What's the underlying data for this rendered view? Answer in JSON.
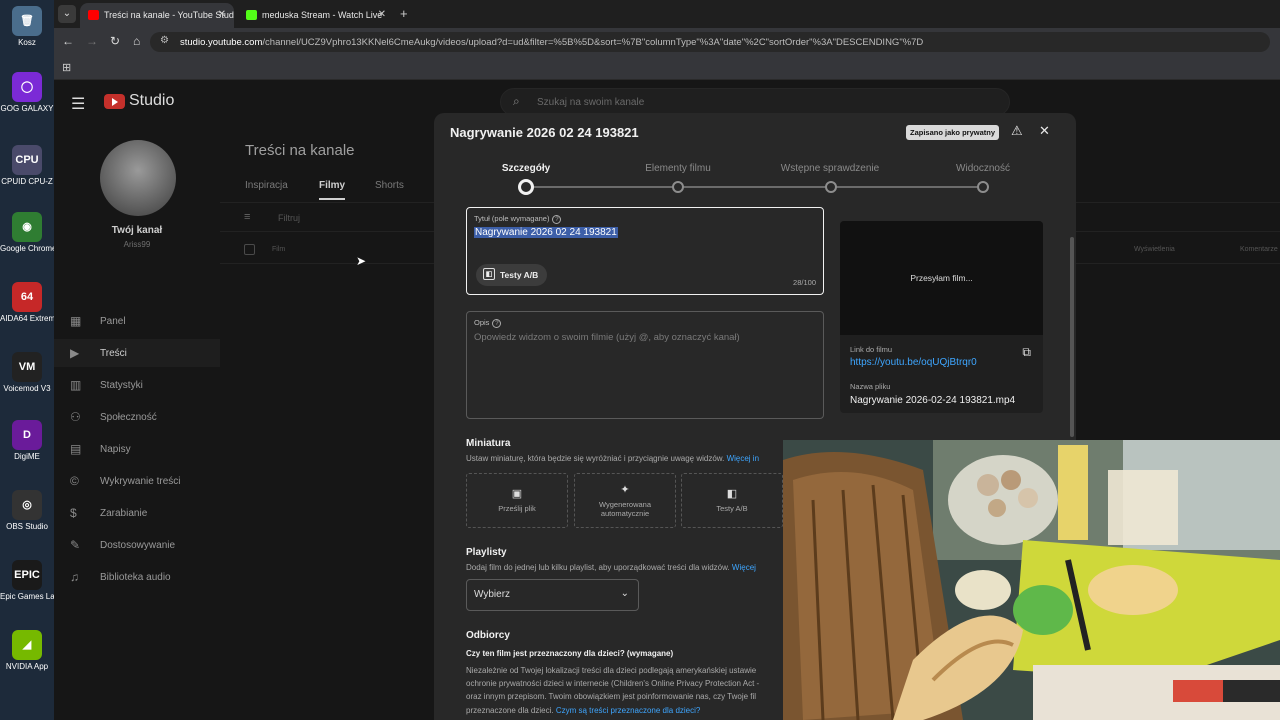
{
  "desktop": {
    "icons": [
      {
        "label": "Kosz",
        "icon": "recycle-bin-icon",
        "color": "#4a6d8c",
        "glyph": "🗑"
      },
      {
        "label": "GOG GALAXY",
        "icon": "gog-galaxy-icon",
        "color": "#7b2ad6",
        "glyph": "◯"
      },
      {
        "label": "CPUID CPU-Z",
        "icon": "cpuz-icon",
        "color": "#4a4a6a",
        "glyph": "CPU"
      },
      {
        "label": "Google Chrome",
        "icon": "chrome-icon",
        "color": "#2f7d32",
        "glyph": "◉"
      },
      {
        "label": "AIDA64 Extreme",
        "icon": "aida64-icon",
        "color": "#c62828",
        "glyph": "64"
      },
      {
        "label": "Voicemod V3",
        "icon": "voicemod-icon",
        "color": "#222222",
        "glyph": "VM"
      },
      {
        "label": "DigiME",
        "icon": "digime-icon",
        "color": "#6a1b9a",
        "glyph": "D"
      },
      {
        "label": "OBS Studio",
        "icon": "obs-icon",
        "color": "#333333",
        "glyph": "◎"
      },
      {
        "label": "Epic Games Launcher",
        "icon": "epic-games-icon",
        "color": "#1a1a1a",
        "glyph": "EPIC"
      },
      {
        "label": "NVIDIA App",
        "icon": "nvidia-icon",
        "color": "#76b900",
        "glyph": "◢"
      }
    ]
  },
  "browser": {
    "tabs": [
      {
        "title": "Treści na kanale - YouTube Studio",
        "favicon_color": "#ff0000",
        "active": true
      },
      {
        "title": "meduska Stream - Watch Live",
        "favicon_color": "#53fc18",
        "active": false
      }
    ],
    "url_site": "studio.youtube.com",
    "url_path": "/channel/UCZ9Vphro13KKNel6CmeAukg/videos/upload?d=ud&filter=%5B%5D&sort=%7B\"columnType\"%3A\"date\"%2C\"sortOrder\"%3A\"DESCENDING\"%7D"
  },
  "studio": {
    "logo_text": "Studio",
    "search_placeholder": "Szukaj na swoim kanale",
    "channel": {
      "title": "Twój kanał",
      "name": "Ariss99"
    },
    "nav": [
      {
        "label": "Panel",
        "icon": "dashboard-icon",
        "glyph": "▦"
      },
      {
        "label": "Treści",
        "icon": "content-icon",
        "glyph": "▶"
      },
      {
        "label": "Statystyki",
        "icon": "analytics-icon",
        "glyph": "▥"
      },
      {
        "label": "Społeczność",
        "icon": "community-icon",
        "glyph": "⚇"
      },
      {
        "label": "Napisy",
        "icon": "subtitles-icon",
        "glyph": "▤"
      },
      {
        "label": "Wykrywanie treści",
        "icon": "copyright-icon",
        "glyph": "©"
      },
      {
        "label": "Zarabianie",
        "icon": "monetization-icon",
        "glyph": "$"
      },
      {
        "label": "Dostosowywanie",
        "icon": "customization-icon",
        "glyph": "✎"
      },
      {
        "label": "Biblioteka audio",
        "icon": "audio-library-icon",
        "glyph": "♫"
      }
    ],
    "active_nav": "Treści",
    "content_title": "Treści na kanale",
    "content_tabs": [
      "Inspiracja",
      "Filmy",
      "Shorts"
    ],
    "active_tab": "Filmy",
    "filter_text": "Filtruj",
    "columns": [
      "Film",
      "Wyświetlenia",
      "Komentarze"
    ]
  },
  "dialog": {
    "title": "Nagrywanie 2026 02 24 193821",
    "saved_badge": "Zapisano jako prywatny",
    "steps": [
      "Szczegóły",
      "Elementy filmu",
      "Wstępne sprawdzenie",
      "Widoczność"
    ],
    "current_step": 0,
    "title_field": {
      "label": "Tytuł (pole wymagane)",
      "value": "Nagrywanie 2026 02 24 193821",
      "counter": "28/100",
      "ab_label": "Testy A/B"
    },
    "description_field": {
      "label": "Opis",
      "placeholder": "Opowiedz widzom o swoim filmie (użyj @, aby oznaczyć kanał)"
    },
    "preview": {
      "status": "Przesyłam film...",
      "link_label": "Link do filmu",
      "link": "https://youtu.be/oqUQjBtrqr0",
      "file_label": "Nazwa pliku",
      "file_name": "Nagrywanie 2026-02-24 193821.mp4"
    },
    "thumbnail": {
      "heading": "Miniatura",
      "description": "Ustaw miniaturę, która będzie się wyróżniać i przyciągnie uwagę widzów.",
      "more": "Więcej in",
      "options": [
        {
          "label": "Prześlij plik",
          "icon": "upload-image-icon",
          "glyph": "▣"
        },
        {
          "label": "Wygenerowana automatycznie",
          "icon": "auto-generate-icon",
          "glyph": "✦"
        },
        {
          "label": "Testy A/B",
          "icon": "ab-test-icon",
          "glyph": "◧"
        }
      ]
    },
    "playlists": {
      "heading": "Playlisty",
      "description": "Dodaj film do jednej lub kilku playlist, aby uporządkować treści dla widzów.",
      "more": "Więcej",
      "select": "Wybierz"
    },
    "audience": {
      "heading": "Odbiorcy",
      "question": "Czy ten film jest przeznaczony dla dzieci? (wymagane)",
      "lines": [
        "Niezależnie od Twojej lokalizacji treści dla dzieci podlegają amerykańskiej ustawie",
        "ochronie prywatności dzieci w internecie (Children's Online Privacy Protection Act -",
        "oraz innym przepisom. Twoim obowiązkiem jest poinformowanie nas, czy Twoje fil"
      ],
      "last_line": "przeznaczone dla dzieci.",
      "link": "Czym są treści przeznaczone dla dzieci?"
    }
  }
}
